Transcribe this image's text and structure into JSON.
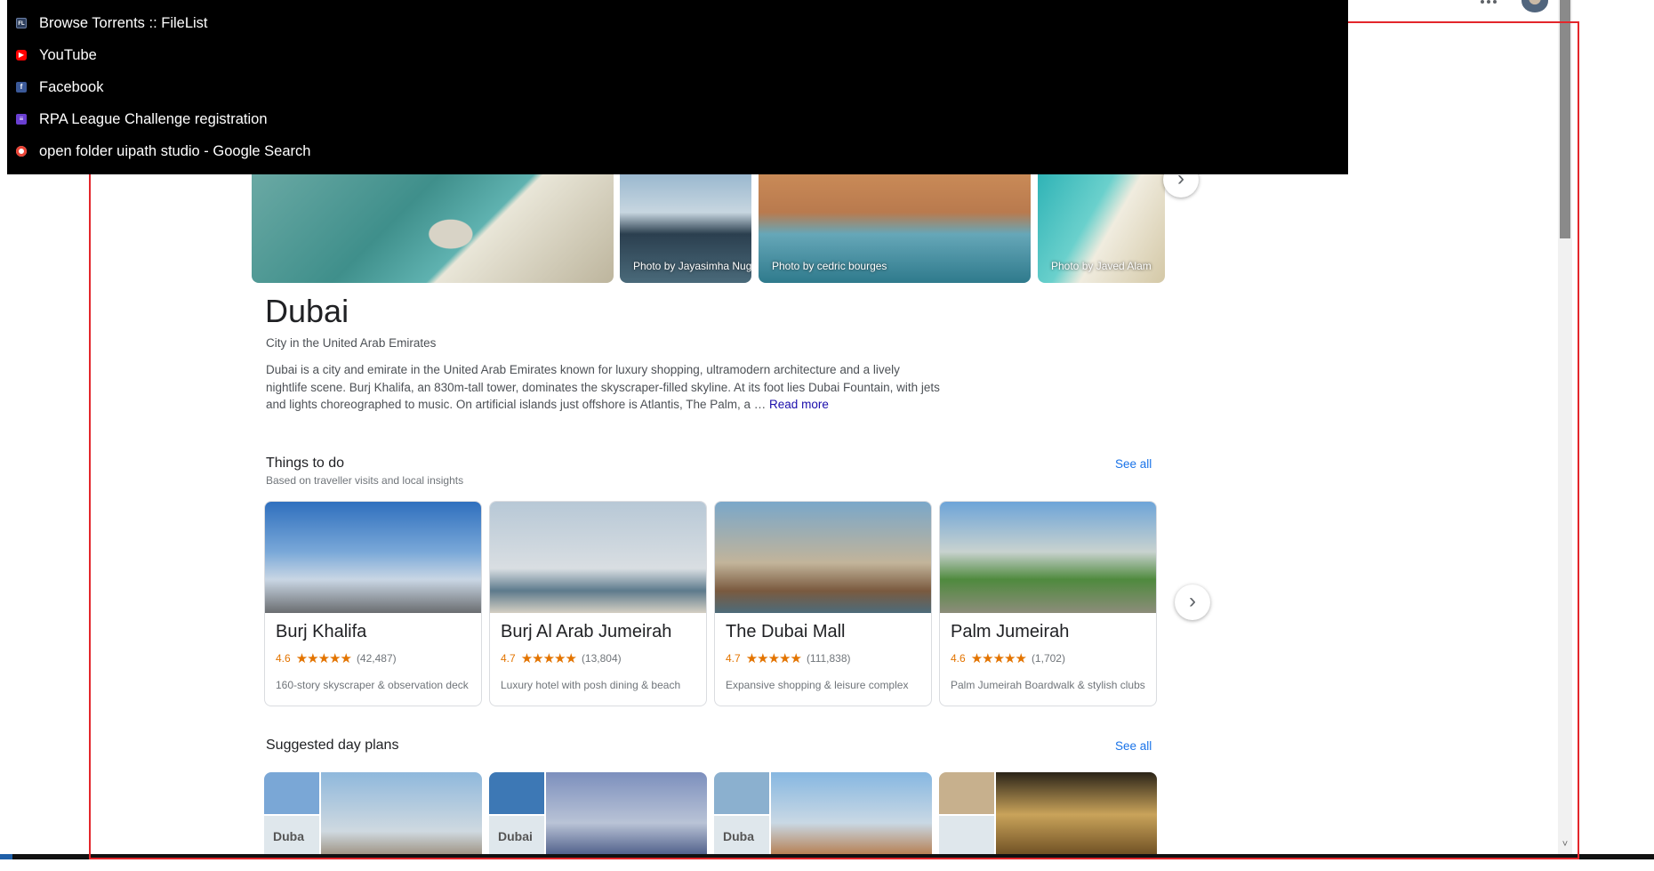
{
  "history_dropdown": {
    "items": [
      {
        "favicon": "filelist-icon",
        "label": "Browse Torrents :: FileList"
      },
      {
        "favicon": "youtube-icon",
        "label": "YouTube"
      },
      {
        "favicon": "facebook-icon",
        "label": "Facebook"
      },
      {
        "favicon": "rpa-league-icon",
        "label": "RPA League Challenge registration"
      },
      {
        "favicon": "google-icon",
        "label": "open folder uipath studio - Google Search"
      }
    ]
  },
  "photos": [
    {
      "credit": ""
    },
    {
      "credit": "Photo by Jayasimha Nugg"
    },
    {
      "credit": "Photo by cedric bourges"
    },
    {
      "credit": "Photo by Javed Alam"
    }
  ],
  "place": {
    "title": "Dubai",
    "subtitle": "City in the United Arab Emirates",
    "description": "Dubai is a city and emirate in the United Arab Emirates known for luxury shopping, ultramodern architecture and a lively nightlife scene. Burj Khalifa, an 830m-tall tower, dominates the skyscraper-filled skyline. At its foot lies Dubai Fountain, with jets and lights choreographed to music. On artificial islands just offshore is Atlantis, The Palm, a …",
    "read_more": "Read more"
  },
  "things_to_do": {
    "title": "Things to do",
    "subtitle": "Based on traveller visits and local insights",
    "see_all": "See all",
    "cards": [
      {
        "name": "Burj Khalifa",
        "rating": "4.6",
        "stars": "★★★★★",
        "reviews": "(42,487)",
        "desc": "160-story skyscraper & observation deck"
      },
      {
        "name": "Burj Al Arab Jumeirah",
        "rating": "4.7",
        "stars": "★★★★★",
        "reviews": "(13,804)",
        "desc": "Luxury hotel with posh dining & beach"
      },
      {
        "name": "The Dubai Mall",
        "rating": "4.7",
        "stars": "★★★★★",
        "reviews": "(111,838)",
        "desc": "Expansive shopping & leisure complex"
      },
      {
        "name": "Palm Jumeirah",
        "rating": "4.6",
        "stars": "★★★★★",
        "reviews": "(1,702)",
        "desc": "Palm Jumeirah Boardwalk & stylish clubs"
      }
    ]
  },
  "day_plans": {
    "title": "Suggested day plans",
    "see_all": "See all",
    "plans": [
      {
        "label": "Duba"
      },
      {
        "label": "Dubai"
      },
      {
        "label": "Duba"
      },
      {
        "label": ""
      }
    ]
  },
  "icons": {
    "next": "›",
    "scroll_down": "˅"
  }
}
